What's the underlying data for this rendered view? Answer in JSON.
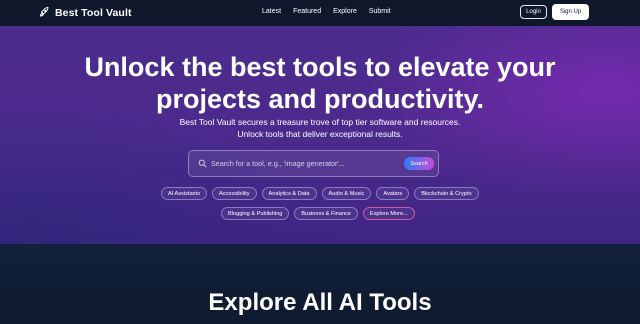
{
  "header": {
    "brand": "Best Tool Vault",
    "nav": [
      "Latest",
      "Featured",
      "Explore",
      "Submit"
    ],
    "login_label": "Login",
    "signup_label": "Sign Up"
  },
  "hero": {
    "title": "Unlock the best tools to elevate your projects and productivity.",
    "subtitle_line1": "Best Tool Vault secures a treasure trove of top tier software and resources.",
    "subtitle_line2": "Unlock tools that deliver exceptional results.",
    "search": {
      "placeholder": "Search for a tool, e.g., 'image generator'...",
      "button_label": "Search"
    },
    "chips_row1": [
      "AI Assistants",
      "Accessibility",
      "Analytics & Data",
      "Audio & Music",
      "Avatars",
      "Blockchain & Crypto"
    ],
    "chips_row2": [
      "Blogging & Publishing",
      "Business & Finance",
      "Explore More..."
    ]
  },
  "section": {
    "title": "Explore All AI Tools"
  },
  "colors": {
    "header_bg": "#0f172a",
    "hero_bg": "#4b2c8c",
    "chip_border": "#8b7ac8",
    "search_button_start": "#2f7cf6",
    "search_button_end": "#c84bd9"
  }
}
